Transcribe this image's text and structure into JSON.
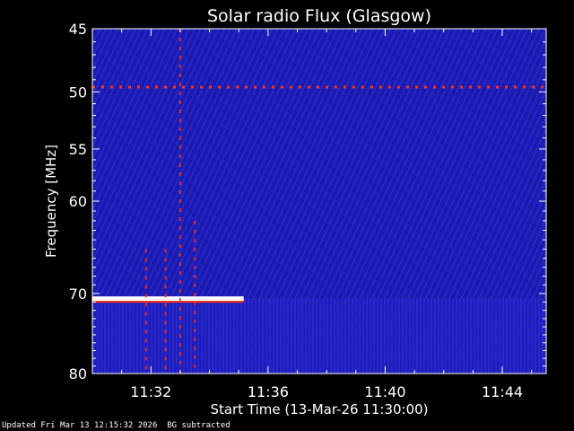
{
  "chart_data": {
    "type": "heatmap",
    "title": "Solar radio Flux (Glasgow)",
    "xlabel": "Start Time (13-Mar-26 11:30:00)",
    "ylabel": "Frequency [MHz]",
    "xlim": [
      "11:30:00",
      "11:45:30"
    ],
    "ylim": [
      45,
      80
    ],
    "y_reversed": true,
    "y_scale": "log",
    "x_ticks": [
      "11:32",
      "11:36",
      "11:40",
      "11:44"
    ],
    "y_ticks": [
      45,
      50,
      55,
      60,
      70,
      80
    ],
    "colormap": {
      "low": "#0a0a5e",
      "mid": "#2b2bd6",
      "high": "#ff3010",
      "max": "#ffffff"
    },
    "features": [
      {
        "kind": "horizontal-line",
        "freq_mhz": 49.6,
        "t_start": "11:30:00",
        "t_end": "11:45:30",
        "intensity": "high"
      },
      {
        "kind": "horizontal-line",
        "freq_mhz": 70.6,
        "t_start": "11:30:00",
        "t_end": "11:35:10",
        "intensity": "max"
      },
      {
        "kind": "vertical-burst",
        "time": "11:31:50",
        "f_start": 65,
        "f_end": 80
      },
      {
        "kind": "vertical-burst",
        "time": "11:32:30",
        "f_start": 65,
        "f_end": 80
      },
      {
        "kind": "vertical-burst",
        "time": "11:33:00",
        "f_start": 45,
        "f_end": 80
      },
      {
        "kind": "vertical-burst",
        "time": "11:33:30",
        "f_start": 62,
        "f_end": 80
      }
    ]
  },
  "footer": {
    "updated": "Updated Fri Mar 13 12:15:32 2026",
    "note": "BG subtracted"
  }
}
